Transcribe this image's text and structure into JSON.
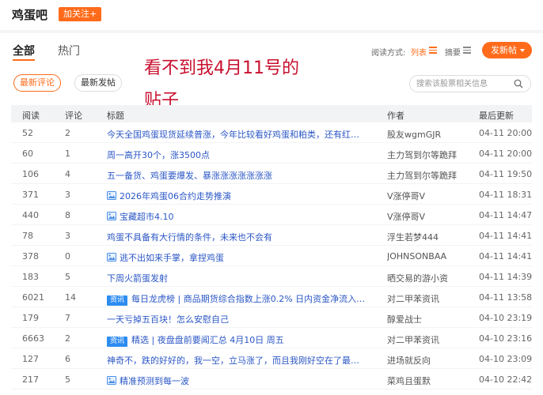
{
  "header": {
    "bar_name": "鸡蛋吧",
    "follow_label": "加关注+"
  },
  "tabs": [
    {
      "label": "全部",
      "active": true
    },
    {
      "label": "热门",
      "active": false
    }
  ],
  "view": {
    "mode_label": "阅读方式:",
    "list_label": "列表",
    "summary_label": "摘要",
    "post_label": "发新帖"
  },
  "annotation": {
    "line1": "看不到我4月11号的",
    "line2": "贴子"
  },
  "filters": {
    "latest_reply": "最新评论",
    "latest_post": "最新发帖"
  },
  "search": {
    "placeholder": "搜索该股票相关信息"
  },
  "table": {
    "columns": {
      "reads": "阅读",
      "comments": "评论",
      "title": "标题",
      "author": "作者",
      "updated": "最后更新"
    },
    "rows": [
      {
        "reads": "52",
        "comments": "2",
        "title": "今天全国鸡蛋现货延续普涨，今年比较看好鸡蛋和粕类，还有红…",
        "author": "股友wgmGJR",
        "updated": "04-11 20:00",
        "image": false,
        "tag": ""
      },
      {
        "reads": "60",
        "comments": "1",
        "title": "周一高开30个，涨3500点",
        "author": "主力驾到尔等跪拜",
        "updated": "04-11 20:00",
        "image": false,
        "tag": ""
      },
      {
        "reads": "106",
        "comments": "4",
        "title": "五一备货、鸡蛋要爆发、暴涨涨涨涨涨涨涨",
        "author": "主力驾到尔等跪拜",
        "updated": "04-11 19:50",
        "image": false,
        "tag": ""
      },
      {
        "reads": "371",
        "comments": "3",
        "title": "2026年鸡蛋06合约走势推演",
        "author": "V涨停哥V",
        "updated": "04-11 18:31",
        "image": true,
        "tag": ""
      },
      {
        "reads": "440",
        "comments": "8",
        "title": "宝藏超市4.10",
        "author": "V涨停哥V",
        "updated": "04-11 14:47",
        "image": true,
        "tag": ""
      },
      {
        "reads": "78",
        "comments": "3",
        "title": "鸡蛋不具备有大行情的条件，未来也不会有",
        "author": "浮生若梦444",
        "updated": "04-11 14:41",
        "image": false,
        "tag": ""
      },
      {
        "reads": "378",
        "comments": "0",
        "title": "逃不出如来手掌，拿捏鸡蛋",
        "author": "JOHNSONBAA",
        "updated": "04-11 14:41",
        "image": true,
        "tag": ""
      },
      {
        "reads": "183",
        "comments": "5",
        "title": "下周火箭蛋发射",
        "author": "晒交易的游小资",
        "updated": "04-11 14:39",
        "image": false,
        "tag": ""
      },
      {
        "reads": "6021",
        "comments": "14",
        "title": "每日龙虎榜 | 商品期货综合指数上涨0.2% 日内资金净流入…",
        "author": "对二甲苯资讯",
        "updated": "04-11 13:58",
        "image": false,
        "tag": "资讯"
      },
      {
        "reads": "179",
        "comments": "7",
        "title": "一天亏掉五百块！怎么安慰自己",
        "author": "醇爱战士",
        "updated": "04-10 23:19",
        "image": false,
        "tag": ""
      },
      {
        "reads": "6663",
        "comments": "2",
        "title": "精选 | 夜盘盘前要闻汇总 4月10日 周五",
        "author": "对二甲苯资讯",
        "updated": "04-10 23:16",
        "image": false,
        "tag": "资讯"
      },
      {
        "reads": "127",
        "comments": "6",
        "title": "神奇不，跌的好好的，我一空，立马涨了，而且我刚好空在了最…",
        "author": "进场就反向",
        "updated": "04-10 23:09",
        "image": false,
        "tag": ""
      },
      {
        "reads": "217",
        "comments": "5",
        "title": "精准预测到每一波",
        "author": "菜鸡且蛋默",
        "updated": "04-10 22:42",
        "image": true,
        "tag": ""
      }
    ]
  }
}
